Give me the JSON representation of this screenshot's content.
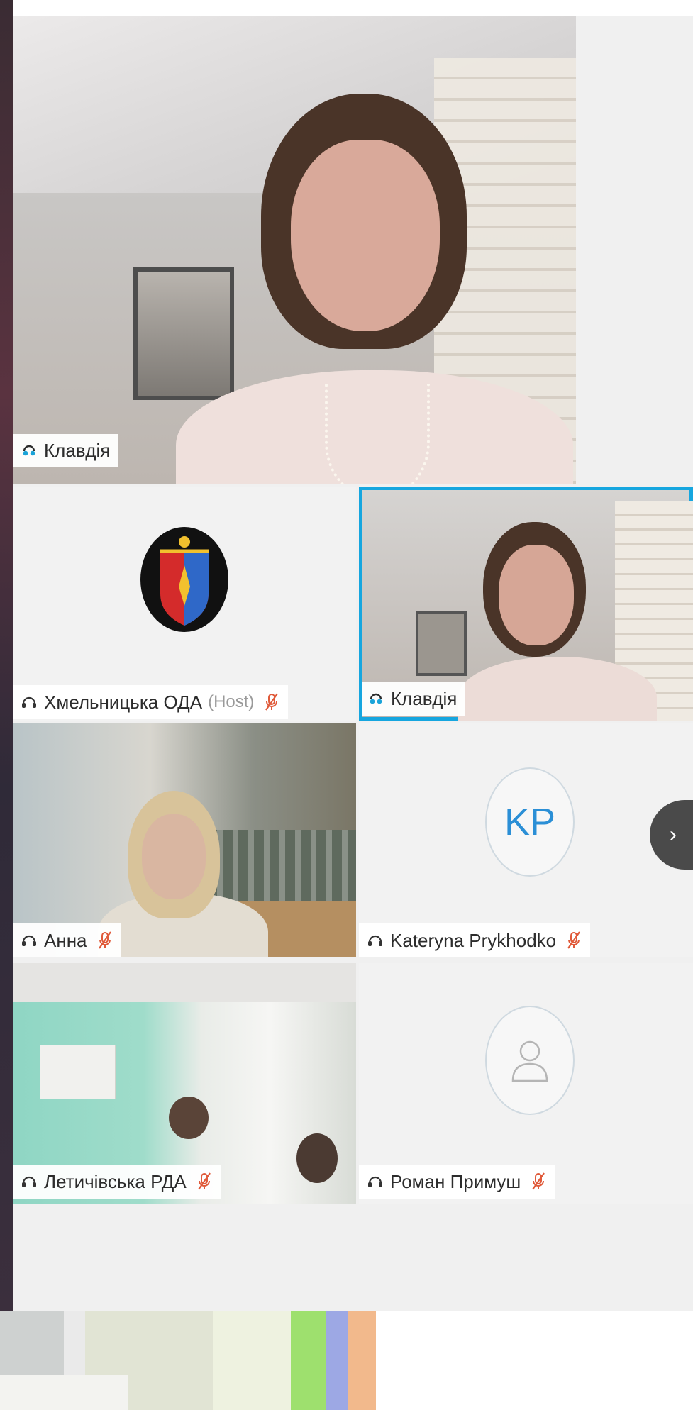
{
  "participants": [
    {
      "id": "main",
      "name": "Клавдія",
      "speaking": true
    },
    {
      "id": "host",
      "name": "Хмельницька ОДА",
      "role": "(Host)",
      "muted": true
    },
    {
      "id": "self",
      "name": "Клавдія",
      "speaking": true,
      "highlighted": true
    },
    {
      "id": "anna",
      "name": "Анна",
      "muted": true
    },
    {
      "id": "kp",
      "name": "Kateryna Prykhodko",
      "initials": "KP",
      "muted": true
    },
    {
      "id": "letych",
      "name": "Летичівська РДА",
      "muted": true
    },
    {
      "id": "roman",
      "name": "Роман Примуш",
      "muted": true
    }
  ],
  "nav": {
    "next_arrow": "›"
  },
  "colors": {
    "highlight": "#16a6df",
    "speaking": "#1aa3d8",
    "muted": "#e05a3a",
    "initials": "#2b8fd6"
  }
}
